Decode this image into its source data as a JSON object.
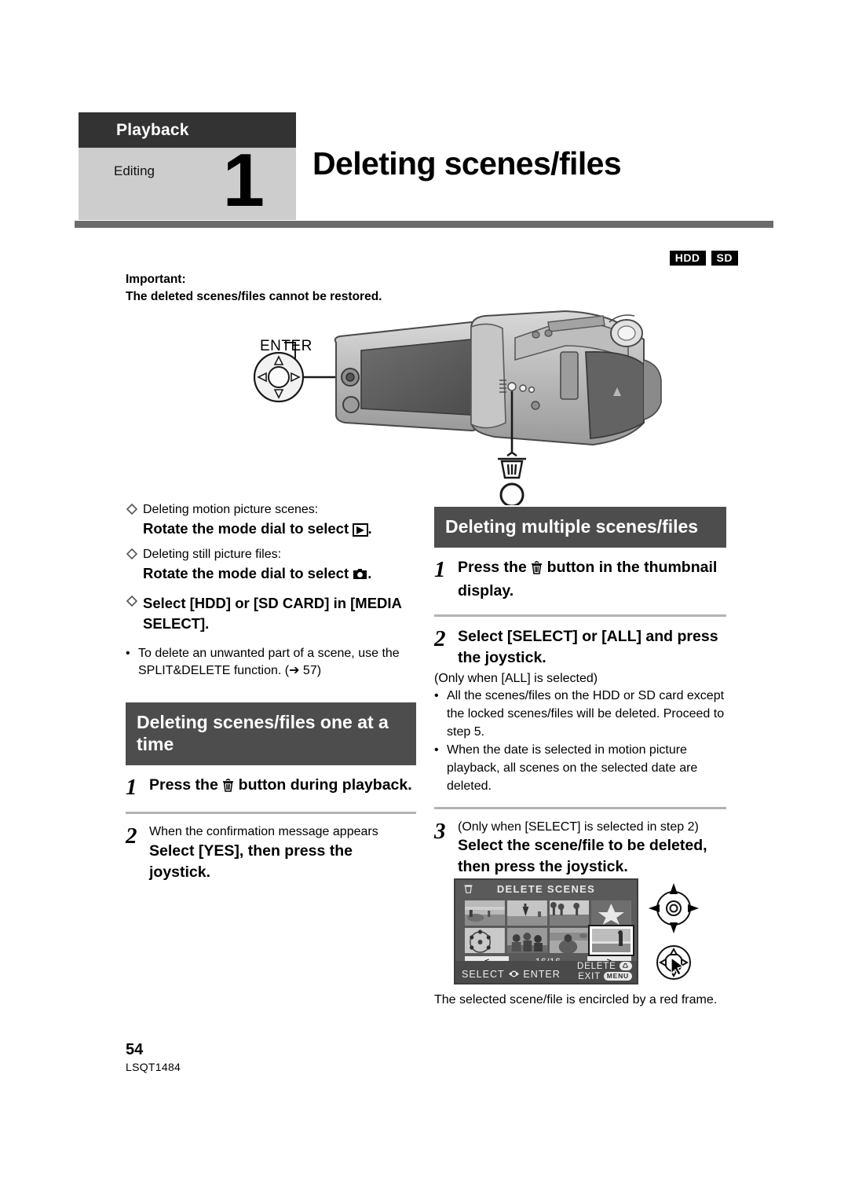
{
  "header": {
    "category": "Playback",
    "subcategory": "Editing",
    "number": "1",
    "title": "Deleting scenes/files"
  },
  "badges": [
    "HDD",
    "SD"
  ],
  "important": {
    "label": "Important:",
    "text": "The deleted scenes/files cannot be restored."
  },
  "illustration": {
    "enter_label": "ENTER",
    "joystick_icon": "joystick-icon",
    "trash_icon": "trash-icon",
    "camcorder_icon": "camcorder-illustration"
  },
  "left_column": {
    "conditions": [
      {
        "lead": "Deleting motion picture scenes:",
        "action_prefix": "Rotate the mode dial to select",
        "action_icon": "play-mode-icon",
        "action_suffix": "."
      },
      {
        "lead": "Deleting still picture files:",
        "action_prefix": "Rotate the mode dial to select",
        "action_icon": "still-picture-mode-icon",
        "action_suffix": "."
      },
      {
        "lead": "",
        "bold_only": "Select [HDD] or [SD CARD] in [MEDIA SELECT]."
      }
    ],
    "note": "To delete an unwanted part of a scene, use the SPLIT&DELETE function. (➔ 57)",
    "section_heading": "Deleting scenes/files one at a time",
    "steps": [
      {
        "num": "1",
        "bold_before": "Press the",
        "icon": "trash-icon",
        "bold_after": "button during playback."
      },
      {
        "num": "2",
        "regular": "When the confirmation message appears",
        "bold": "Select [YES], then press the joystick."
      }
    ]
  },
  "right_column": {
    "section_heading": "Deleting multiple scenes/files",
    "steps": [
      {
        "num": "1",
        "bold_before": "Press the",
        "icon": "trash-icon",
        "bold_after": "button in the thumbnail display."
      },
      {
        "num": "2",
        "bold": "Select [SELECT] or [ALL] and press the joystick.",
        "sub_note": "(Only when [ALL] is selected)",
        "bullets": [
          "All the scenes/files on the HDD or SD card except the locked scenes/files will be deleted. Proceed to step 5.",
          "When the date is selected in motion picture playback, all scenes on the selected date are deleted."
        ]
      },
      {
        "num": "3",
        "regular": "(Only when [SELECT] is selected in step 2)",
        "bold": "Select the scene/file to be deleted, then press the joystick."
      }
    ],
    "caption": "The selected scene/file is encircled by a red frame."
  },
  "lcd_screen": {
    "title": "DELETE SCENES",
    "trash_icon": "trash-icon",
    "counter": "16/16",
    "prev_label": "<",
    "next_label": ">",
    "bar_left": "SELECT",
    "bar_left_suffix": "ENTER",
    "bar_joystick_icon": "joystick-icon",
    "bar_delete": "DELETE",
    "bar_delete_key": "trash-key-icon",
    "bar_exit": "EXIT",
    "bar_exit_key": "MENU",
    "thumbnail_count": 8,
    "selected_thumbnail_index": 7
  },
  "side_icons": {
    "joystick_directions_icon": "joystick-directions-icon",
    "joystick_press_icon": "joystick-press-icon"
  },
  "footer": {
    "page_number": "54",
    "document_code": "LSQT1484"
  },
  "colors": {
    "header_dark": "#333333",
    "header_light": "#cdcdcd",
    "rule": "#6b6b6b",
    "section_heading_bg": "#4d4d4d",
    "divider": "#b3b3b3",
    "badge_bg": "#000000"
  }
}
